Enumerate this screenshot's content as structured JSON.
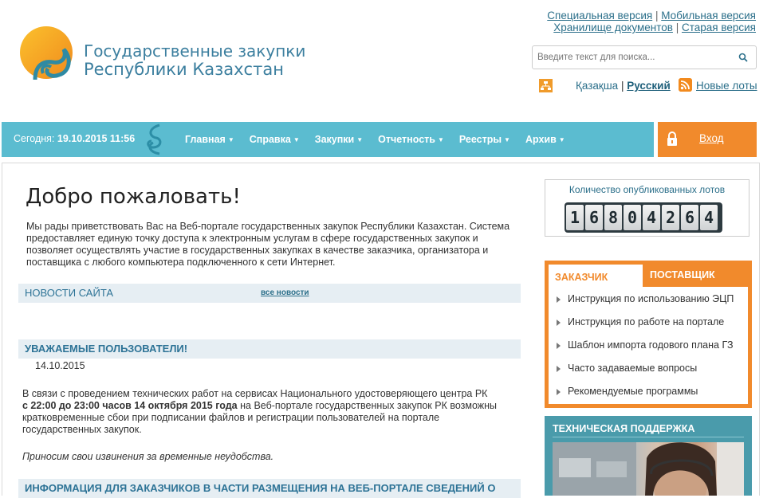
{
  "header": {
    "logo_line1": "Государственные закупки",
    "logo_line2": "Республики Казахстан",
    "links_row1": [
      "Специальная версия",
      "Мобильная версия"
    ],
    "links_row2": [
      "Хранилище документов",
      "Старая версия"
    ],
    "separator": "|",
    "search_placeholder": "Введите текст для поиска...",
    "lang_kz": "Қазақша",
    "lang_ru": "Русский",
    "new_lots": "Новые лоты"
  },
  "nav": {
    "today_label": "Сегодня:",
    "today_value": "19.10.2015 11:56",
    "menu": [
      "Главная",
      "Справка",
      "Закупки",
      "Отчетность",
      "Реестры",
      "Архив"
    ],
    "login": "Вход"
  },
  "main": {
    "welcome": "Добро пожаловать!",
    "intro": "Мы рады приветствовать Вас на Веб-портале государственных закупок Республики Казахстан. Система предоставляет единую точку доступа к электронным услугам в сфере государственных закупок и позволяет осуществлять участие в государственных закупках в качестве заказчика, организатора и поставщика с любого компьютера подключенного к сети Интернет.",
    "news_header": "НОВОСТИ САЙТА",
    "all_news": "все новости",
    "item1_title": "УВАЖАЕМЫЕ ПОЛЬЗОВАТЕЛИ!",
    "item1_date": "14.10.2015",
    "item1_text_a": "В связи с проведением технических работ на сервисах Национального удостоверяющего центра РК",
    "item1_text_b": "с 22:00 до 23:00 часов 14 октября 2015 года",
    "item1_text_c": " на Веб-портале государственных закупок РК возможны кратковременные сбои при подписании файлов и регистрации пользователей на портале государственных закупок.",
    "item1_apology": "Приносим свои извинения за временные неудобства.",
    "item2_title": "ИНФОРМАЦИЯ ДЛЯ ЗАКАЗЧИКОВ В ЧАСТИ РАЗМЕЩЕНИЯ НА ВЕБ-ПОРТАЛЕ СВЕДЕНИЙ О"
  },
  "sidebar": {
    "counter_title": "Количество опубликованных лотов",
    "counter_digits": [
      "1",
      "6",
      "8",
      "0",
      "4",
      "2",
      "6",
      "4"
    ],
    "tab_customer": "ЗАКАЗЧИК",
    "tab_supplier": "ПОСТАВЩИК",
    "links": [
      "Инструкция по использованию ЭЦП",
      "Инструкция по работе на портале",
      "Шаблон импорта годового плана ГЗ",
      "Часто задаваемые вопросы",
      "Рекомендуемые программы"
    ],
    "support_title": "ТЕХНИЧЕСКАЯ ПОДДЕРЖКА"
  },
  "colors": {
    "nav_bg": "#5bbcd0",
    "accent_orange": "#f18a2c",
    "link_blue": "#2b6f8a"
  }
}
